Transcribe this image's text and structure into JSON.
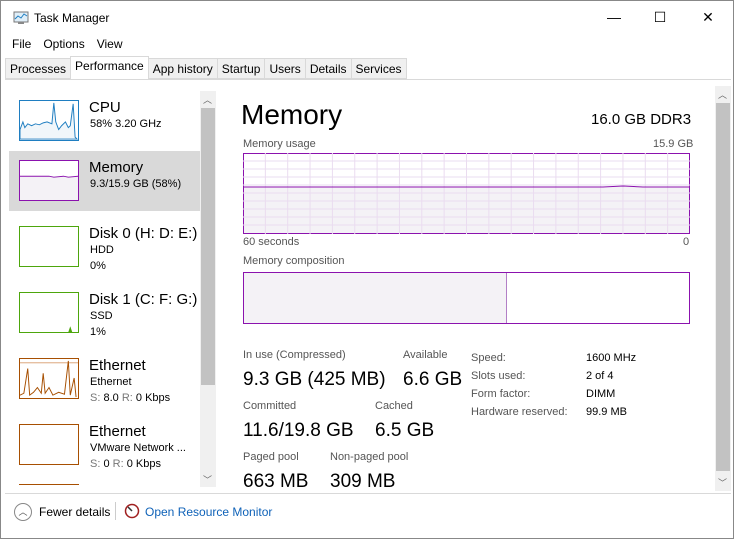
{
  "window": {
    "title": "Task Manager",
    "minimize": "—",
    "maximize": "☐",
    "close": "✕"
  },
  "menu": [
    "File",
    "Options",
    "View"
  ],
  "tabs": [
    "Processes",
    "Performance",
    "App history",
    "Startup",
    "Users",
    "Details",
    "Services"
  ],
  "sidebar": [
    {
      "name": "CPU",
      "line1": "58% 3.20 GHz",
      "color": "#1f7ec1"
    },
    {
      "name": "Memory",
      "line1": "9.3/15.9 GB (58%)",
      "color": "#8b12ae"
    },
    {
      "name": "Disk 0 (H: D: E:)",
      "line1": "HDD",
      "line2": "0%",
      "color": "#4da60c"
    },
    {
      "name": "Disk 1 (C: F: G:)",
      "line1": "SSD",
      "line2": "1%",
      "color": "#4da60c"
    },
    {
      "name": "Ethernet",
      "line1": "Ethernet",
      "line2_s": "S:",
      "line2_sv": "8.0",
      "line2_r": "R:",
      "line2_rv": "0 Kbps",
      "color": "#a74f01"
    },
    {
      "name": "Ethernet",
      "line1": "VMware Network ...",
      "line2_s": "S:",
      "line2_sv": "0",
      "line2_r": "R:",
      "line2_rv": "0 Kbps",
      "color": "#a74f01"
    }
  ],
  "main": {
    "title": "Memory",
    "spec": "16.0 GB DDR3",
    "usage_label": "Memory usage",
    "usage_max": "15.9 GB",
    "time_label": "60 seconds",
    "time_min": "0",
    "usage_percent": 58,
    "composition_label": "Memory composition",
    "composition_in_use_fraction": 0.59,
    "stats": {
      "in_use_label": "In use (Compressed)",
      "in_use": "9.3 GB (425 MB)",
      "available_label": "Available",
      "available": "6.6 GB",
      "committed_label": "Committed",
      "committed": "11.6/19.8 GB",
      "cached_label": "Cached",
      "cached": "6.5 GB",
      "paged_label": "Paged pool",
      "paged": "663 MB",
      "nonpaged_label": "Non-paged pool",
      "nonpaged": "309 MB"
    },
    "specs": [
      [
        "Speed:",
        "1600 MHz"
      ],
      [
        "Slots used:",
        "2 of 4"
      ],
      [
        "Form factor:",
        "DIMM"
      ],
      [
        "Hardware reserved:",
        "99.9 MB"
      ]
    ]
  },
  "footer": {
    "fewer": "Fewer details",
    "monitor": "Open Resource Monitor"
  }
}
